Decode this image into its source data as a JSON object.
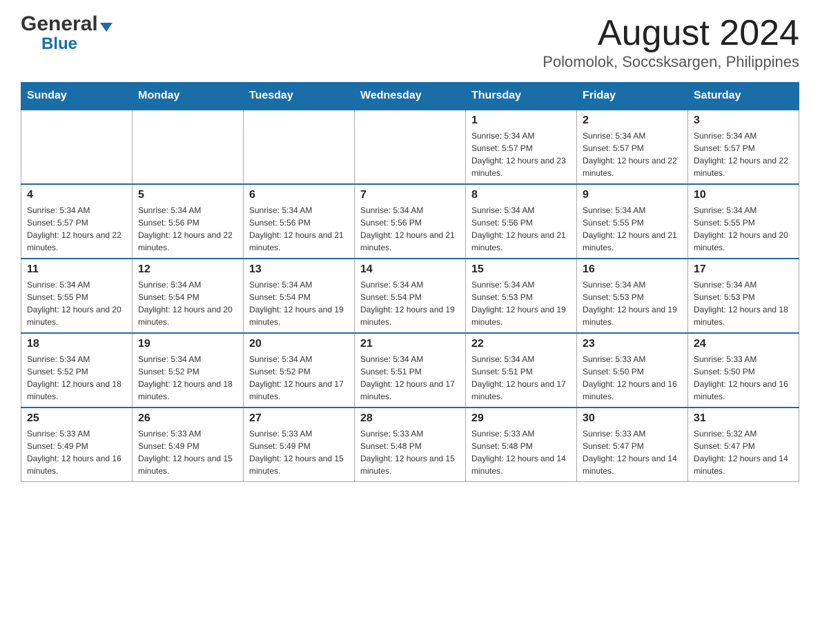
{
  "logo": {
    "general": "General",
    "blue": "Blue"
  },
  "title": "August 2024",
  "subtitle": "Polomolok, Soccsksargen, Philippines",
  "days_of_week": [
    "Sunday",
    "Monday",
    "Tuesday",
    "Wednesday",
    "Thursday",
    "Friday",
    "Saturday"
  ],
  "weeks": [
    [
      {
        "day": "",
        "sunrise": "",
        "sunset": "",
        "daylight": ""
      },
      {
        "day": "",
        "sunrise": "",
        "sunset": "",
        "daylight": ""
      },
      {
        "day": "",
        "sunrise": "",
        "sunset": "",
        "daylight": ""
      },
      {
        "day": "",
        "sunrise": "",
        "sunset": "",
        "daylight": ""
      },
      {
        "day": "1",
        "sunrise": "Sunrise: 5:34 AM",
        "sunset": "Sunset: 5:57 PM",
        "daylight": "Daylight: 12 hours and 23 minutes."
      },
      {
        "day": "2",
        "sunrise": "Sunrise: 5:34 AM",
        "sunset": "Sunset: 5:57 PM",
        "daylight": "Daylight: 12 hours and 22 minutes."
      },
      {
        "day": "3",
        "sunrise": "Sunrise: 5:34 AM",
        "sunset": "Sunset: 5:57 PM",
        "daylight": "Daylight: 12 hours and 22 minutes."
      }
    ],
    [
      {
        "day": "4",
        "sunrise": "Sunrise: 5:34 AM",
        "sunset": "Sunset: 5:57 PM",
        "daylight": "Daylight: 12 hours and 22 minutes."
      },
      {
        "day": "5",
        "sunrise": "Sunrise: 5:34 AM",
        "sunset": "Sunset: 5:56 PM",
        "daylight": "Daylight: 12 hours and 22 minutes."
      },
      {
        "day": "6",
        "sunrise": "Sunrise: 5:34 AM",
        "sunset": "Sunset: 5:56 PM",
        "daylight": "Daylight: 12 hours and 21 minutes."
      },
      {
        "day": "7",
        "sunrise": "Sunrise: 5:34 AM",
        "sunset": "Sunset: 5:56 PM",
        "daylight": "Daylight: 12 hours and 21 minutes."
      },
      {
        "day": "8",
        "sunrise": "Sunrise: 5:34 AM",
        "sunset": "Sunset: 5:56 PM",
        "daylight": "Daylight: 12 hours and 21 minutes."
      },
      {
        "day": "9",
        "sunrise": "Sunrise: 5:34 AM",
        "sunset": "Sunset: 5:55 PM",
        "daylight": "Daylight: 12 hours and 21 minutes."
      },
      {
        "day": "10",
        "sunrise": "Sunrise: 5:34 AM",
        "sunset": "Sunset: 5:55 PM",
        "daylight": "Daylight: 12 hours and 20 minutes."
      }
    ],
    [
      {
        "day": "11",
        "sunrise": "Sunrise: 5:34 AM",
        "sunset": "Sunset: 5:55 PM",
        "daylight": "Daylight: 12 hours and 20 minutes."
      },
      {
        "day": "12",
        "sunrise": "Sunrise: 5:34 AM",
        "sunset": "Sunset: 5:54 PM",
        "daylight": "Daylight: 12 hours and 20 minutes."
      },
      {
        "day": "13",
        "sunrise": "Sunrise: 5:34 AM",
        "sunset": "Sunset: 5:54 PM",
        "daylight": "Daylight: 12 hours and 19 minutes."
      },
      {
        "day": "14",
        "sunrise": "Sunrise: 5:34 AM",
        "sunset": "Sunset: 5:54 PM",
        "daylight": "Daylight: 12 hours and 19 minutes."
      },
      {
        "day": "15",
        "sunrise": "Sunrise: 5:34 AM",
        "sunset": "Sunset: 5:53 PM",
        "daylight": "Daylight: 12 hours and 19 minutes."
      },
      {
        "day": "16",
        "sunrise": "Sunrise: 5:34 AM",
        "sunset": "Sunset: 5:53 PM",
        "daylight": "Daylight: 12 hours and 19 minutes."
      },
      {
        "day": "17",
        "sunrise": "Sunrise: 5:34 AM",
        "sunset": "Sunset: 5:53 PM",
        "daylight": "Daylight: 12 hours and 18 minutes."
      }
    ],
    [
      {
        "day": "18",
        "sunrise": "Sunrise: 5:34 AM",
        "sunset": "Sunset: 5:52 PM",
        "daylight": "Daylight: 12 hours and 18 minutes."
      },
      {
        "day": "19",
        "sunrise": "Sunrise: 5:34 AM",
        "sunset": "Sunset: 5:52 PM",
        "daylight": "Daylight: 12 hours and 18 minutes."
      },
      {
        "day": "20",
        "sunrise": "Sunrise: 5:34 AM",
        "sunset": "Sunset: 5:52 PM",
        "daylight": "Daylight: 12 hours and 17 minutes."
      },
      {
        "day": "21",
        "sunrise": "Sunrise: 5:34 AM",
        "sunset": "Sunset: 5:51 PM",
        "daylight": "Daylight: 12 hours and 17 minutes."
      },
      {
        "day": "22",
        "sunrise": "Sunrise: 5:34 AM",
        "sunset": "Sunset: 5:51 PM",
        "daylight": "Daylight: 12 hours and 17 minutes."
      },
      {
        "day": "23",
        "sunrise": "Sunrise: 5:33 AM",
        "sunset": "Sunset: 5:50 PM",
        "daylight": "Daylight: 12 hours and 16 minutes."
      },
      {
        "day": "24",
        "sunrise": "Sunrise: 5:33 AM",
        "sunset": "Sunset: 5:50 PM",
        "daylight": "Daylight: 12 hours and 16 minutes."
      }
    ],
    [
      {
        "day": "25",
        "sunrise": "Sunrise: 5:33 AM",
        "sunset": "Sunset: 5:49 PM",
        "daylight": "Daylight: 12 hours and 16 minutes."
      },
      {
        "day": "26",
        "sunrise": "Sunrise: 5:33 AM",
        "sunset": "Sunset: 5:49 PM",
        "daylight": "Daylight: 12 hours and 15 minutes."
      },
      {
        "day": "27",
        "sunrise": "Sunrise: 5:33 AM",
        "sunset": "Sunset: 5:49 PM",
        "daylight": "Daylight: 12 hours and 15 minutes."
      },
      {
        "day": "28",
        "sunrise": "Sunrise: 5:33 AM",
        "sunset": "Sunset: 5:48 PM",
        "daylight": "Daylight: 12 hours and 15 minutes."
      },
      {
        "day": "29",
        "sunrise": "Sunrise: 5:33 AM",
        "sunset": "Sunset: 5:48 PM",
        "daylight": "Daylight: 12 hours and 14 minutes."
      },
      {
        "day": "30",
        "sunrise": "Sunrise: 5:33 AM",
        "sunset": "Sunset: 5:47 PM",
        "daylight": "Daylight: 12 hours and 14 minutes."
      },
      {
        "day": "31",
        "sunrise": "Sunrise: 5:32 AM",
        "sunset": "Sunset: 5:47 PM",
        "daylight": "Daylight: 12 hours and 14 minutes."
      }
    ]
  ]
}
